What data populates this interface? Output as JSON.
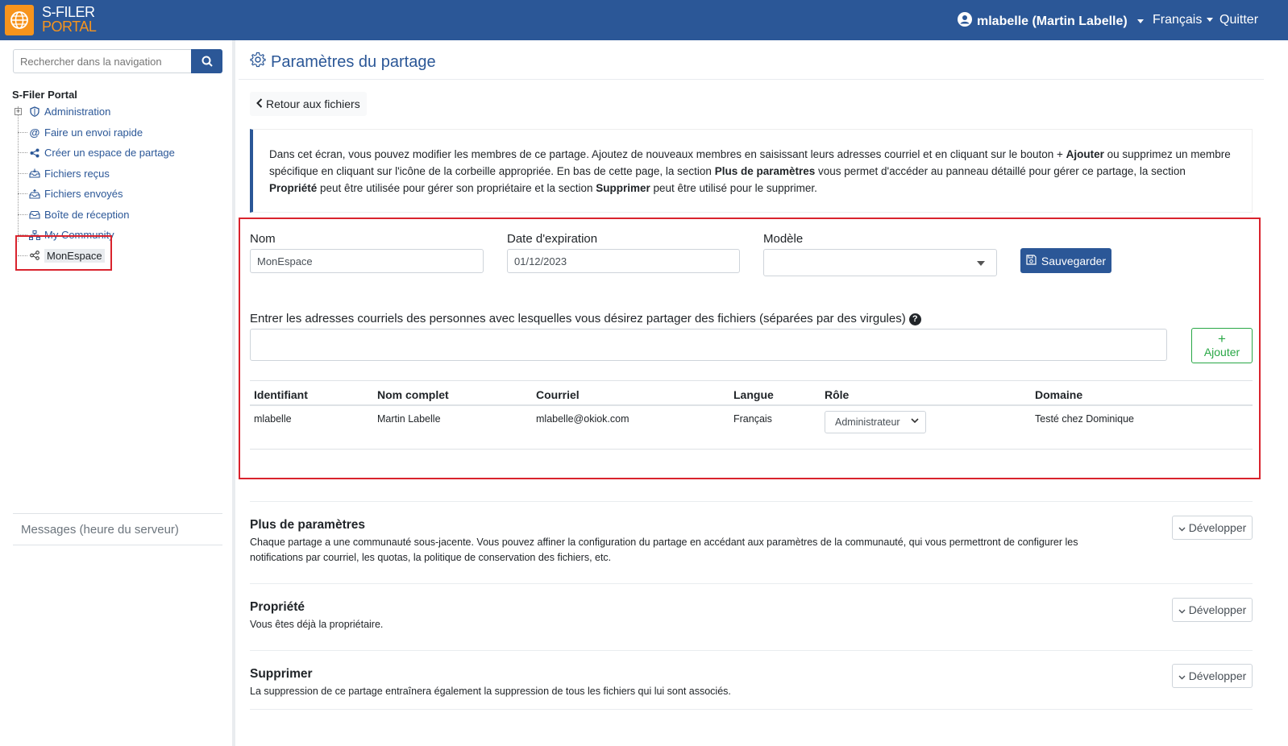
{
  "header": {
    "logo_line1": "S-FILER",
    "logo_line2": "PORTAL",
    "user": "mlabelle (Martin Labelle)",
    "language": "Français",
    "quit": "Quitter"
  },
  "sidebar": {
    "search_placeholder": "Rechercher dans la navigation",
    "tree_title": "S-Filer Portal",
    "items": [
      {
        "label": "Administration",
        "icon": "shield-icon"
      },
      {
        "label": "Faire un envoi rapide",
        "icon": "at-icon"
      },
      {
        "label": "Créer un espace de partage",
        "icon": "share-icon"
      },
      {
        "label": "Fichiers reçus",
        "icon": "inbox-in-icon"
      },
      {
        "label": "Fichiers envoyés",
        "icon": "inbox-out-icon"
      },
      {
        "label": "Boîte de réception",
        "icon": "inbox-icon"
      },
      {
        "label": "My Community",
        "icon": "sitemap-icon"
      },
      {
        "label": "MonEspace",
        "icon": "share-nodes-icon"
      }
    ],
    "messages": "Messages (heure du serveur)"
  },
  "main": {
    "title": "Paramètres du partage",
    "back": "Retour aux fichiers",
    "info": {
      "p1": "Dans cet écran, vous pouvez modifier les membres de ce partage. Ajoutez de nouveaux membres en saisissant leurs adresses courriel et en cliquant sur le bouton + ",
      "b1": "Ajouter",
      "p2": " ou supprimez un membre spécifique en cliquant sur l'icône de la corbeille appropriée. En bas de cette page, la section ",
      "b2": "Plus de paramètres",
      "p3": " vous permet d'accéder au panneau détaillé pour gérer ce partage, la section ",
      "b3": "Propriété",
      "p4": " peut être utilisée pour gérer son propriétaire et la section ",
      "b4": "Supprimer",
      "p5": " peut être utilisé pour le supprimer."
    },
    "form": {
      "name_label": "Nom",
      "name_value": "MonEspace",
      "expiry_label": "Date d'expiration",
      "expiry_value": "01/12/2023",
      "model_label": "Modèle",
      "save": "Sauvegarder",
      "emails_label": "Entrer les adresses courriels des personnes avec lesquelles vous désirez partager des fichiers (séparées par des virgules)",
      "add_plus": "+",
      "add": "Ajouter"
    },
    "table": {
      "headers": [
        "Identifiant",
        "Nom complet",
        "Courriel",
        "Langue",
        "Rôle",
        "Domaine"
      ],
      "rows": [
        {
          "id": "mlabelle",
          "name": "Martin Labelle",
          "email": "mlabelle@okiok.com",
          "lang": "Français",
          "role": "Administrateur",
          "domain": "Testé chez Dominique"
        }
      ]
    },
    "sections": [
      {
        "title": "Plus de paramètres",
        "desc": "Chaque partage a une communauté sous-jacente. Vous pouvez affiner la configuration du partage en accédant aux paramètres de la communauté, qui vous permettront de configurer les notifications par courriel, les quotas, la politique de conservation des fichiers, etc.",
        "button": "Développer"
      },
      {
        "title": "Propriété",
        "desc": "Vous êtes déjà la propriétaire.",
        "button": "Développer"
      },
      {
        "title": "Supprimer",
        "desc": "La suppression de ce partage entraînera également la suppression de tous les fichiers qui lui sont associés.",
        "button": "Développer"
      }
    ]
  },
  "colors": {
    "brand": "#2b5797",
    "accent": "#f7941d",
    "highlight": "#d9232d",
    "success": "#28a745"
  }
}
